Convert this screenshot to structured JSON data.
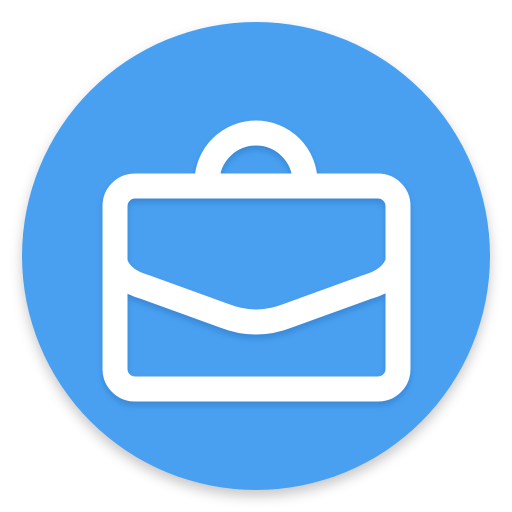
{
  "icon": {
    "name": "briefcase-icon",
    "background_color": "#4a9ff0",
    "foreground_color": "#ffffff",
    "shadow_color": "#1f5fa8"
  }
}
